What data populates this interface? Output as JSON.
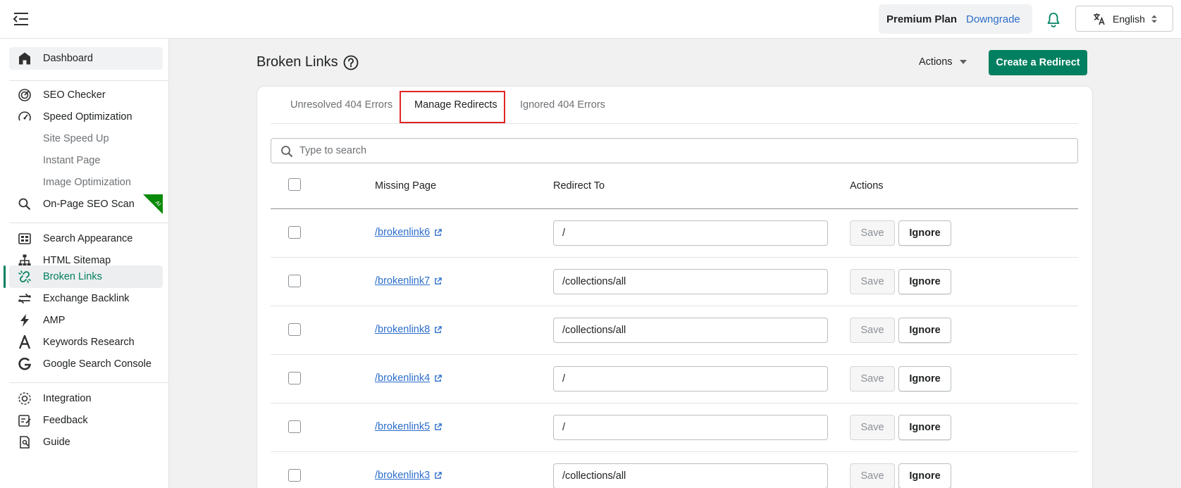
{
  "header": {
    "plan_label": "Premium Plan",
    "downgrade_label": "Downgrade",
    "language": "English"
  },
  "sidebar": {
    "items": [
      {
        "label": "Dashboard",
        "icon": "home-icon"
      },
      {
        "label": "SEO Checker",
        "icon": "seo-checker-icon"
      },
      {
        "label": "Speed Optimization",
        "icon": "speedometer-icon"
      },
      {
        "label": "Site Speed Up"
      },
      {
        "label": "Instant Page"
      },
      {
        "label": "Image Optimization"
      },
      {
        "label": "On-Page SEO Scan",
        "icon": "search-icon",
        "badge": "AI"
      },
      {
        "label": "Search Appearance",
        "icon": "grid-icon"
      },
      {
        "label": "HTML Sitemap",
        "icon": "sitemap-icon"
      },
      {
        "label": "Broken Links",
        "icon": "broken-link-icon"
      },
      {
        "label": "Exchange Backlink",
        "icon": "exchange-icon"
      },
      {
        "label": "AMP",
        "icon": "lightning-icon"
      },
      {
        "label": "Keywords Research",
        "icon": "letter-a-icon"
      },
      {
        "label": "Google Search Console",
        "icon": "google-icon"
      },
      {
        "label": "Integration",
        "icon": "integration-icon"
      },
      {
        "label": "Feedback",
        "icon": "feedback-icon"
      },
      {
        "label": "Guide",
        "icon": "guide-icon"
      }
    ]
  },
  "page": {
    "title": "Broken Links",
    "actions_label": "Actions",
    "create_label": "Create a Redirect"
  },
  "tabs": [
    {
      "label": "Unresolved 404 Errors"
    },
    {
      "label": "Manage Redirects",
      "selected": true
    },
    {
      "label": "Ignored 404 Errors"
    }
  ],
  "search": {
    "placeholder": "Type to search"
  },
  "table": {
    "columns": [
      "Missing Page",
      "Redirect To",
      "Actions"
    ],
    "save_label": "Save",
    "ignore_label": "Ignore",
    "rows": [
      {
        "missing": "/brokenlink6",
        "redirect": "/"
      },
      {
        "missing": "/brokenlink7",
        "redirect": "/collections/all"
      },
      {
        "missing": "/brokenlink8",
        "redirect": "/collections/all"
      },
      {
        "missing": "/brokenlink4",
        "redirect": "/"
      },
      {
        "missing": "/brokenlink5",
        "redirect": "/"
      },
      {
        "missing": "/brokenlink3",
        "redirect": "/collections/all"
      }
    ]
  },
  "colors": {
    "accent": "#008060",
    "link": "#2c6ecb",
    "highlight": "#e02424"
  }
}
